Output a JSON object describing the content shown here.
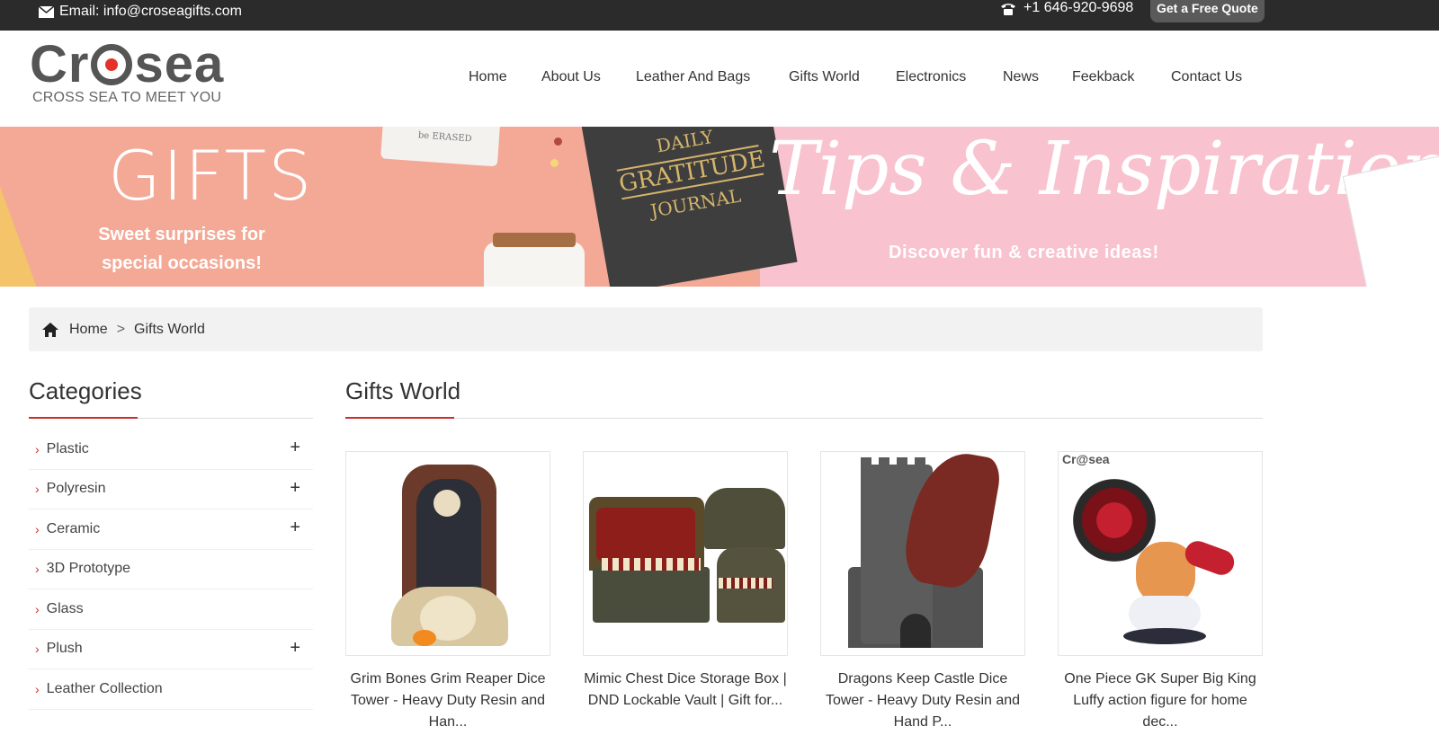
{
  "topbar": {
    "email": "Email: info@croseagifts.com",
    "phone": "+1 646-920-9698",
    "quote_button": "Get a Free Quote"
  },
  "logo": {
    "text_start": "Cr",
    "text_end": "sea",
    "tagline": "CROSS SEA TO MEET YOU"
  },
  "nav": {
    "items": [
      "Home",
      "About Us",
      "Leather And Bags",
      "Gifts World",
      "Electronics",
      "News",
      "Feekback",
      "Contact Us"
    ]
  },
  "banner": {
    "left_title": "GIFTS",
    "left_sub_1": "Sweet surprises for",
    "left_sub_2": "special occasions!",
    "journal_1": "DAILY",
    "journal_2": "GRATITUDE",
    "journal_3": "JOURNAL",
    "card_text": "be ERASED",
    "right_title": "Tips & Inspiration",
    "right_sub": "Discover fun & creative ideas!"
  },
  "breadcrumb": {
    "home": "Home",
    "separator": ">",
    "current": "Gifts World"
  },
  "sidebar": {
    "title": "Categories",
    "categories": [
      {
        "label": "Plastic",
        "expandable": "+"
      },
      {
        "label": "Polyresin",
        "expandable": "+"
      },
      {
        "label": "Ceramic",
        "expandable": "+"
      },
      {
        "label": "3D Prototype",
        "expandable": ""
      },
      {
        "label": "Glass",
        "expandable": ""
      },
      {
        "label": "Plush",
        "expandable": "+"
      },
      {
        "label": "Leather Collection",
        "expandable": ""
      }
    ]
  },
  "main": {
    "title": "Gifts World",
    "products": [
      {
        "name": "Grim Bones Grim Reaper Dice Tower - Heavy Duty Resin and Han..."
      },
      {
        "name": "Mimic Chest Dice Storage Box | DND Lockable Vault | Gift for..."
      },
      {
        "name": "Dragons Keep Castle Dice Tower - Heavy Duty Resin and Hand P..."
      },
      {
        "name": "One Piece GK Super Big King Luffy action figure for home dec..."
      }
    ],
    "product_watermark": "Cr@sea"
  },
  "colors": {
    "topbar_bg": "#2b2b2b",
    "accent_red": "#c9302c",
    "banner_left": "#f3a996",
    "banner_right": "#f9c2cf"
  }
}
